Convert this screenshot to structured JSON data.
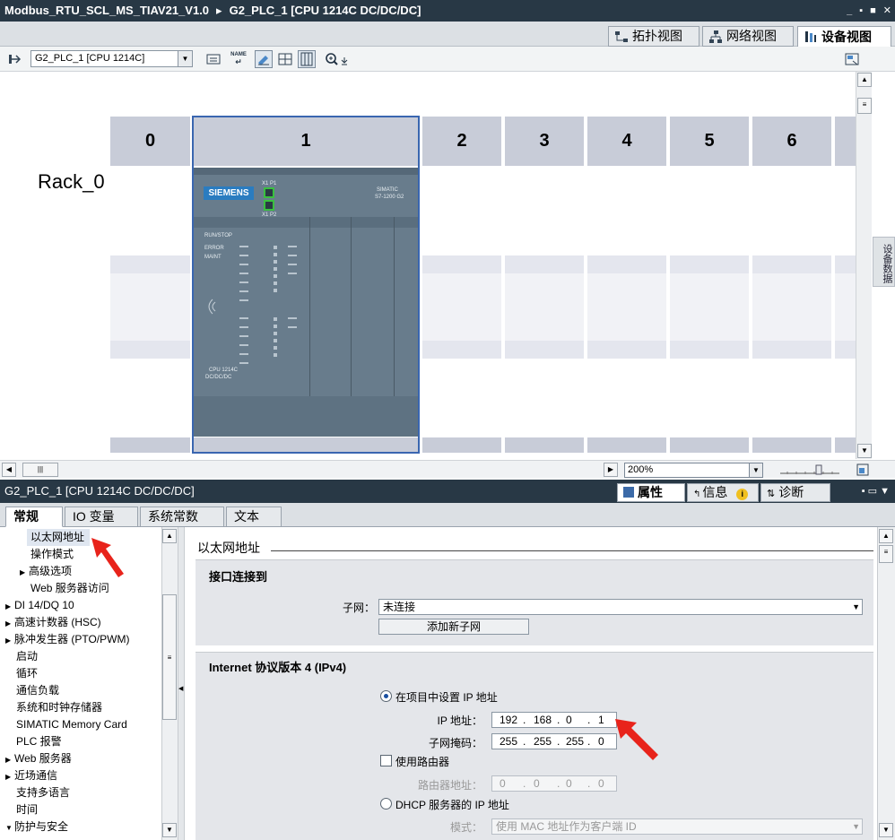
{
  "title_bar": {
    "project": "Modbus_RTU_SCL_MS_TIAV21_V1.0",
    "separator": "▸",
    "device": "G2_PLC_1 [CPU 1214C DC/DC/DC]",
    "window_buttons": [
      "_",
      "▪",
      "■",
      "✕"
    ]
  },
  "view_tabs": [
    {
      "label": "拓扑视图",
      "icon": "topology-icon"
    },
    {
      "label": "网络视图",
      "icon": "network-icon"
    },
    {
      "label": "设备视图",
      "icon": "device-icon"
    }
  ],
  "device_toolbar": {
    "device_selector": "G2_PLC_1 [CPU 1214C]",
    "name_button": "NAME"
  },
  "rack": {
    "label": "Rack_0",
    "slots": [
      "0",
      "1",
      "2",
      "3",
      "4",
      "5",
      "6"
    ],
    "cpu": {
      "brand": "SIEMENS",
      "family_line1": "SIMATIC",
      "family_line2": "S7-1200 G2",
      "status_leds": [
        "RUN/STOP",
        "ERROR",
        "MAINT"
      ],
      "port1": "X1 P1",
      "port2": "X1 P2",
      "model_line1": "CPU 1214C",
      "model_line2": "DC/DC/DC"
    }
  },
  "side_tab": "设备数据",
  "zoom": {
    "value": "200%"
  },
  "properties_header": {
    "title": "G2_PLC_1 [CPU 1214C DC/DC/DC]",
    "tabs": [
      {
        "label": "属性",
        "icon": "properties-icon"
      },
      {
        "label": "信息",
        "icon": "info-icon"
      },
      {
        "label": "诊断",
        "icon": "diagnostics-icon"
      }
    ]
  },
  "inspector_tabs": [
    "常规",
    "IO 变量",
    "系统常数",
    "文本"
  ],
  "tree": [
    {
      "label": "以太网地址",
      "level": 2,
      "selected": true
    },
    {
      "label": "操作模式",
      "level": 2
    },
    {
      "label": "高级选项",
      "level": 1,
      "expandable": true
    },
    {
      "label": "Web 服务器访问",
      "level": 2
    },
    {
      "label": "DI 14/DQ 10",
      "level": 0,
      "expandable": true
    },
    {
      "label": "高速计数器 (HSC)",
      "level": 0,
      "expandable": true
    },
    {
      "label": "脉冲发生器 (PTO/PWM)",
      "level": 0,
      "expandable": true
    },
    {
      "label": "启动",
      "level": 0
    },
    {
      "label": "循环",
      "level": 0
    },
    {
      "label": "通信负载",
      "level": 0
    },
    {
      "label": "系统和时钟存储器",
      "level": 0
    },
    {
      "label": "SIMATIC Memory Card",
      "level": 0
    },
    {
      "label": "PLC 报警",
      "level": 0
    },
    {
      "label": "Web 服务器",
      "level": 0,
      "expandable": true
    },
    {
      "label": "近场通信",
      "level": 0,
      "expandable": true
    },
    {
      "label": "支持多语言",
      "level": 0
    },
    {
      "label": "时间",
      "level": 0
    },
    {
      "label": "防护与安全",
      "level": 0,
      "expanded": true
    }
  ],
  "content": {
    "section_title": "以太网地址",
    "interface_group": {
      "title": "接口连接到",
      "subnet_label": "子网：",
      "subnet_value": "未连接",
      "add_subnet_button": "添加新子网"
    },
    "ipv4_group": {
      "title": "Internet 协议版本 4 (IPv4)",
      "set_in_project": "在项目中设置 IP 地址",
      "ip_label": "IP 地址：",
      "ip": [
        "192",
        "168",
        "0",
        "1"
      ],
      "mask_label": "子网掩码：",
      "mask": [
        "255",
        "255",
        "255",
        "0"
      ],
      "use_router": "使用路由器",
      "router_label": "路由器地址：",
      "router": [
        "0",
        "0",
        "0",
        "0"
      ],
      "dhcp": "DHCP 服务器的 IP 地址",
      "mode_label": "模式：",
      "mode_value": "使用 MAC 地址作为客户端 ID"
    }
  },
  "colors": {
    "title_bar": "#283845",
    "rack_header": "#c8ccd8",
    "cpu_body": "#687c8c",
    "selection": "#3a66b0",
    "annotation_arrow": "#e8231b"
  }
}
